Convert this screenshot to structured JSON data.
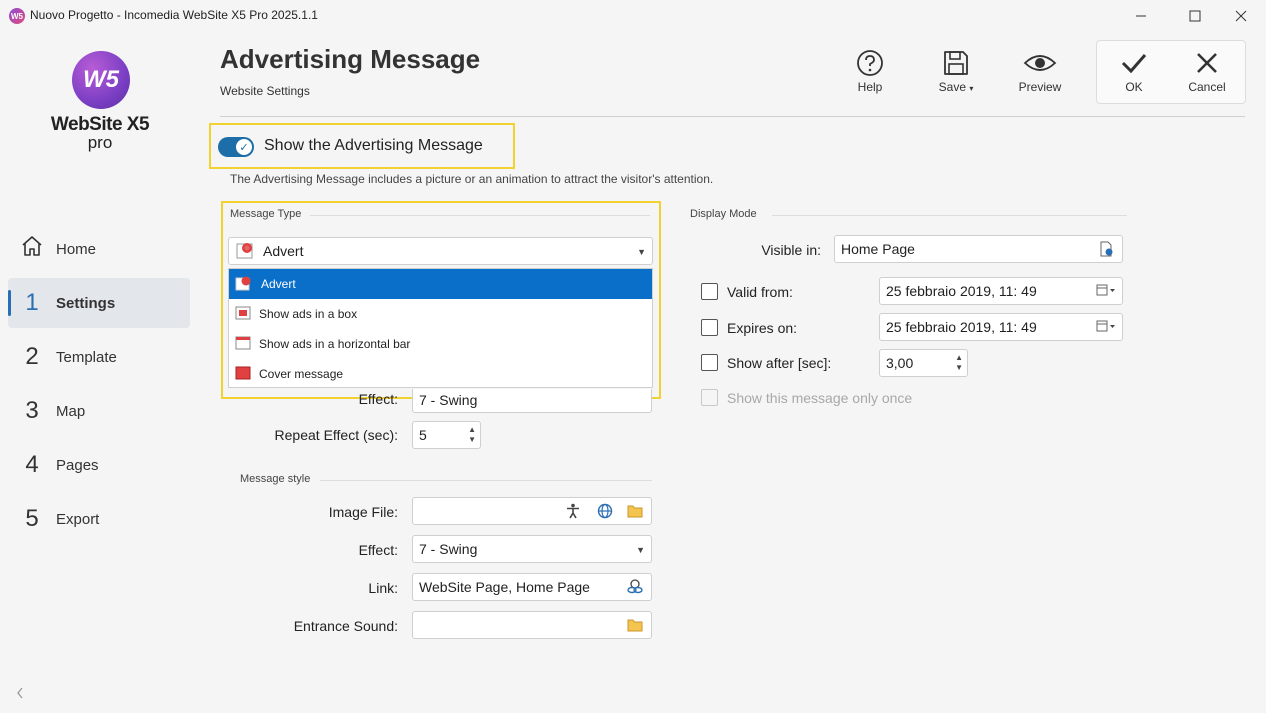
{
  "window": {
    "title": "Nuovo Progetto - Incomedia WebSite X5 Pro 2025.1.1",
    "icon_text": "W5"
  },
  "logo": {
    "mark": "W5",
    "name": "WebSite X5",
    "edition": "pro"
  },
  "nav": [
    {
      "num": "",
      "label": "Home",
      "icon": "home-icon"
    },
    {
      "num": "1",
      "label": "Settings"
    },
    {
      "num": "2",
      "label": "Template"
    },
    {
      "num": "3",
      "label": "Map"
    },
    {
      "num": "4",
      "label": "Pages"
    },
    {
      "num": "5",
      "label": "Export"
    }
  ],
  "header": {
    "title": "Advertising Message",
    "subtitle": "Website Settings"
  },
  "toolbar": {
    "help": "Help",
    "save": "Save",
    "preview": "Preview",
    "ok": "OK",
    "cancel": "Cancel"
  },
  "toggle": {
    "label": "Show the Advertising Message",
    "on": true
  },
  "description": "The Advertising Message includes a picture or an animation to attract the visitor's attention.",
  "message_type": {
    "group_title": "Message Type",
    "selected": "Advert",
    "options": [
      "Advert",
      "Show ads in a box",
      "Show ads in a horizontal bar",
      "Cover message"
    ]
  },
  "effect_partial": {
    "label": "Effect:",
    "value": "7 - Swing"
  },
  "repeat_effect": {
    "label": "Repeat Effect (sec):",
    "value": "5"
  },
  "message_style": {
    "group_title": "Message style",
    "image_file_label": "Image File:",
    "image_file_value": "",
    "effect_label": "Effect:",
    "effect_value": "7 - Swing",
    "link_label": "Link:",
    "link_value": "WebSite Page, Home Page",
    "sound_label": "Entrance Sound:",
    "sound_value": ""
  },
  "display_mode": {
    "group_title": "Display Mode",
    "visible_in_label": "Visible in:",
    "visible_in_value": "Home Page",
    "valid_from_label": "Valid from:",
    "valid_from_value": "25  febbraio  2019, 11: 49",
    "expires_on_label": "Expires on:",
    "expires_on_value": "25  febbraio  2019, 11: 49",
    "show_after_label": "Show after [sec]:",
    "show_after_value": "3,00",
    "once_label": "Show this message only once"
  },
  "colors": {
    "accent": "#0a6fc9",
    "toggle": "#1d6ea8",
    "highlight": "#f2d230"
  }
}
